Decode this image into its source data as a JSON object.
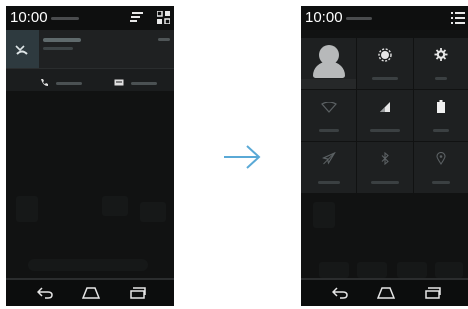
{
  "left_phone": {
    "status_bar": {
      "time": "10:00"
    }
  },
  "right_phone": {
    "status_bar": {
      "time": "10:00"
    }
  },
  "colors": {
    "arrow": "#5aa9d6",
    "screen_bg": "#111212",
    "tile_bg": "#1e2021",
    "notification_accent": "#2e3a3f"
  },
  "icons": {
    "notification": "missed-call-icon",
    "call_back": "phone-icon",
    "message": "message-icon",
    "quick_settings": "quick-settings-icon",
    "settings_toggle": "list-icon",
    "nav": [
      "back-icon",
      "home-icon",
      "recents-icon"
    ],
    "tiles": [
      "avatar-icon",
      "brightness-icon",
      "settings-gear-icon",
      "wifi-icon",
      "signal-icon",
      "battery-icon",
      "airplane-mode-icon",
      "bluetooth-icon",
      "location-icon"
    ]
  }
}
